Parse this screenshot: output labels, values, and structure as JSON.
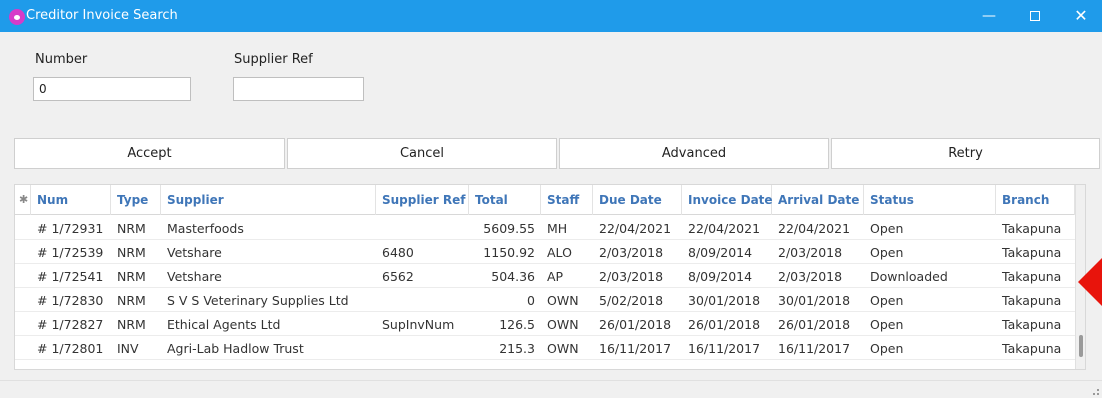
{
  "window": {
    "title": "Creditor Invoice Search"
  },
  "fields": {
    "number": {
      "label": "Number",
      "value": "0"
    },
    "supplier_ref": {
      "label": "Supplier Ref",
      "value": ""
    }
  },
  "buttons": {
    "accept": "Accept",
    "cancel": "Cancel",
    "advanced": "Advanced",
    "retry": "Retry"
  },
  "grid": {
    "columns": [
      "Num",
      "Type",
      "Supplier",
      "Supplier Ref",
      "Total",
      "Staff",
      "Due Date",
      "Invoice Date",
      "Arrival Date",
      "Status",
      "Branch"
    ],
    "rows": [
      {
        "num": "# 1/72931",
        "type": "NRM",
        "supplier": "Masterfoods",
        "supplier_ref": "",
        "total": "5609.55",
        "staff": "MH",
        "due_date": "22/04/2021",
        "invoice_date": "22/04/2021",
        "arrival_date": "22/04/2021",
        "status": "Open",
        "branch": "Takapuna"
      },
      {
        "num": "# 1/72539",
        "type": "NRM",
        "supplier": "Vetshare",
        "supplier_ref": "6480",
        "total": "1150.92",
        "staff": "ALO",
        "due_date": "2/03/2018",
        "invoice_date": "8/09/2014",
        "arrival_date": "2/03/2018",
        "status": "Open",
        "branch": "Takapuna"
      },
      {
        "num": "# 1/72541",
        "type": "NRM",
        "supplier": "Vetshare",
        "supplier_ref": "6562",
        "total": "504.36",
        "staff": "AP",
        "due_date": "2/03/2018",
        "invoice_date": "8/09/2014",
        "arrival_date": "2/03/2018",
        "status": "Downloaded",
        "branch": "Takapuna"
      },
      {
        "num": "# 1/72830",
        "type": "NRM",
        "supplier": "S V S Veterinary Supplies Ltd",
        "supplier_ref": "",
        "total": "0",
        "staff": "OWN",
        "due_date": "5/02/2018",
        "invoice_date": "30/01/2018",
        "arrival_date": "30/01/2018",
        "status": "Open",
        "branch": "Takapuna"
      },
      {
        "num": "# 1/72827",
        "type": "NRM",
        "supplier": "Ethical Agents Ltd",
        "supplier_ref": "SupInvNum",
        "total": "126.5",
        "staff": "OWN",
        "due_date": "26/01/2018",
        "invoice_date": "26/01/2018",
        "arrival_date": "26/01/2018",
        "status": "Open",
        "branch": "Takapuna"
      },
      {
        "num": "# 1/72801",
        "type": "INV",
        "supplier": "Agri-Lab Hadlow Trust",
        "supplier_ref": "",
        "total": "215.3",
        "staff": "OWN",
        "due_date": "16/11/2017",
        "invoice_date": "16/11/2017",
        "arrival_date": "16/11/2017",
        "status": "Open",
        "branch": "Takapuna"
      }
    ]
  },
  "colors": {
    "titlebar": "#1f9bea",
    "header_text": "#3f76b8",
    "pointer": "#e8140c"
  }
}
